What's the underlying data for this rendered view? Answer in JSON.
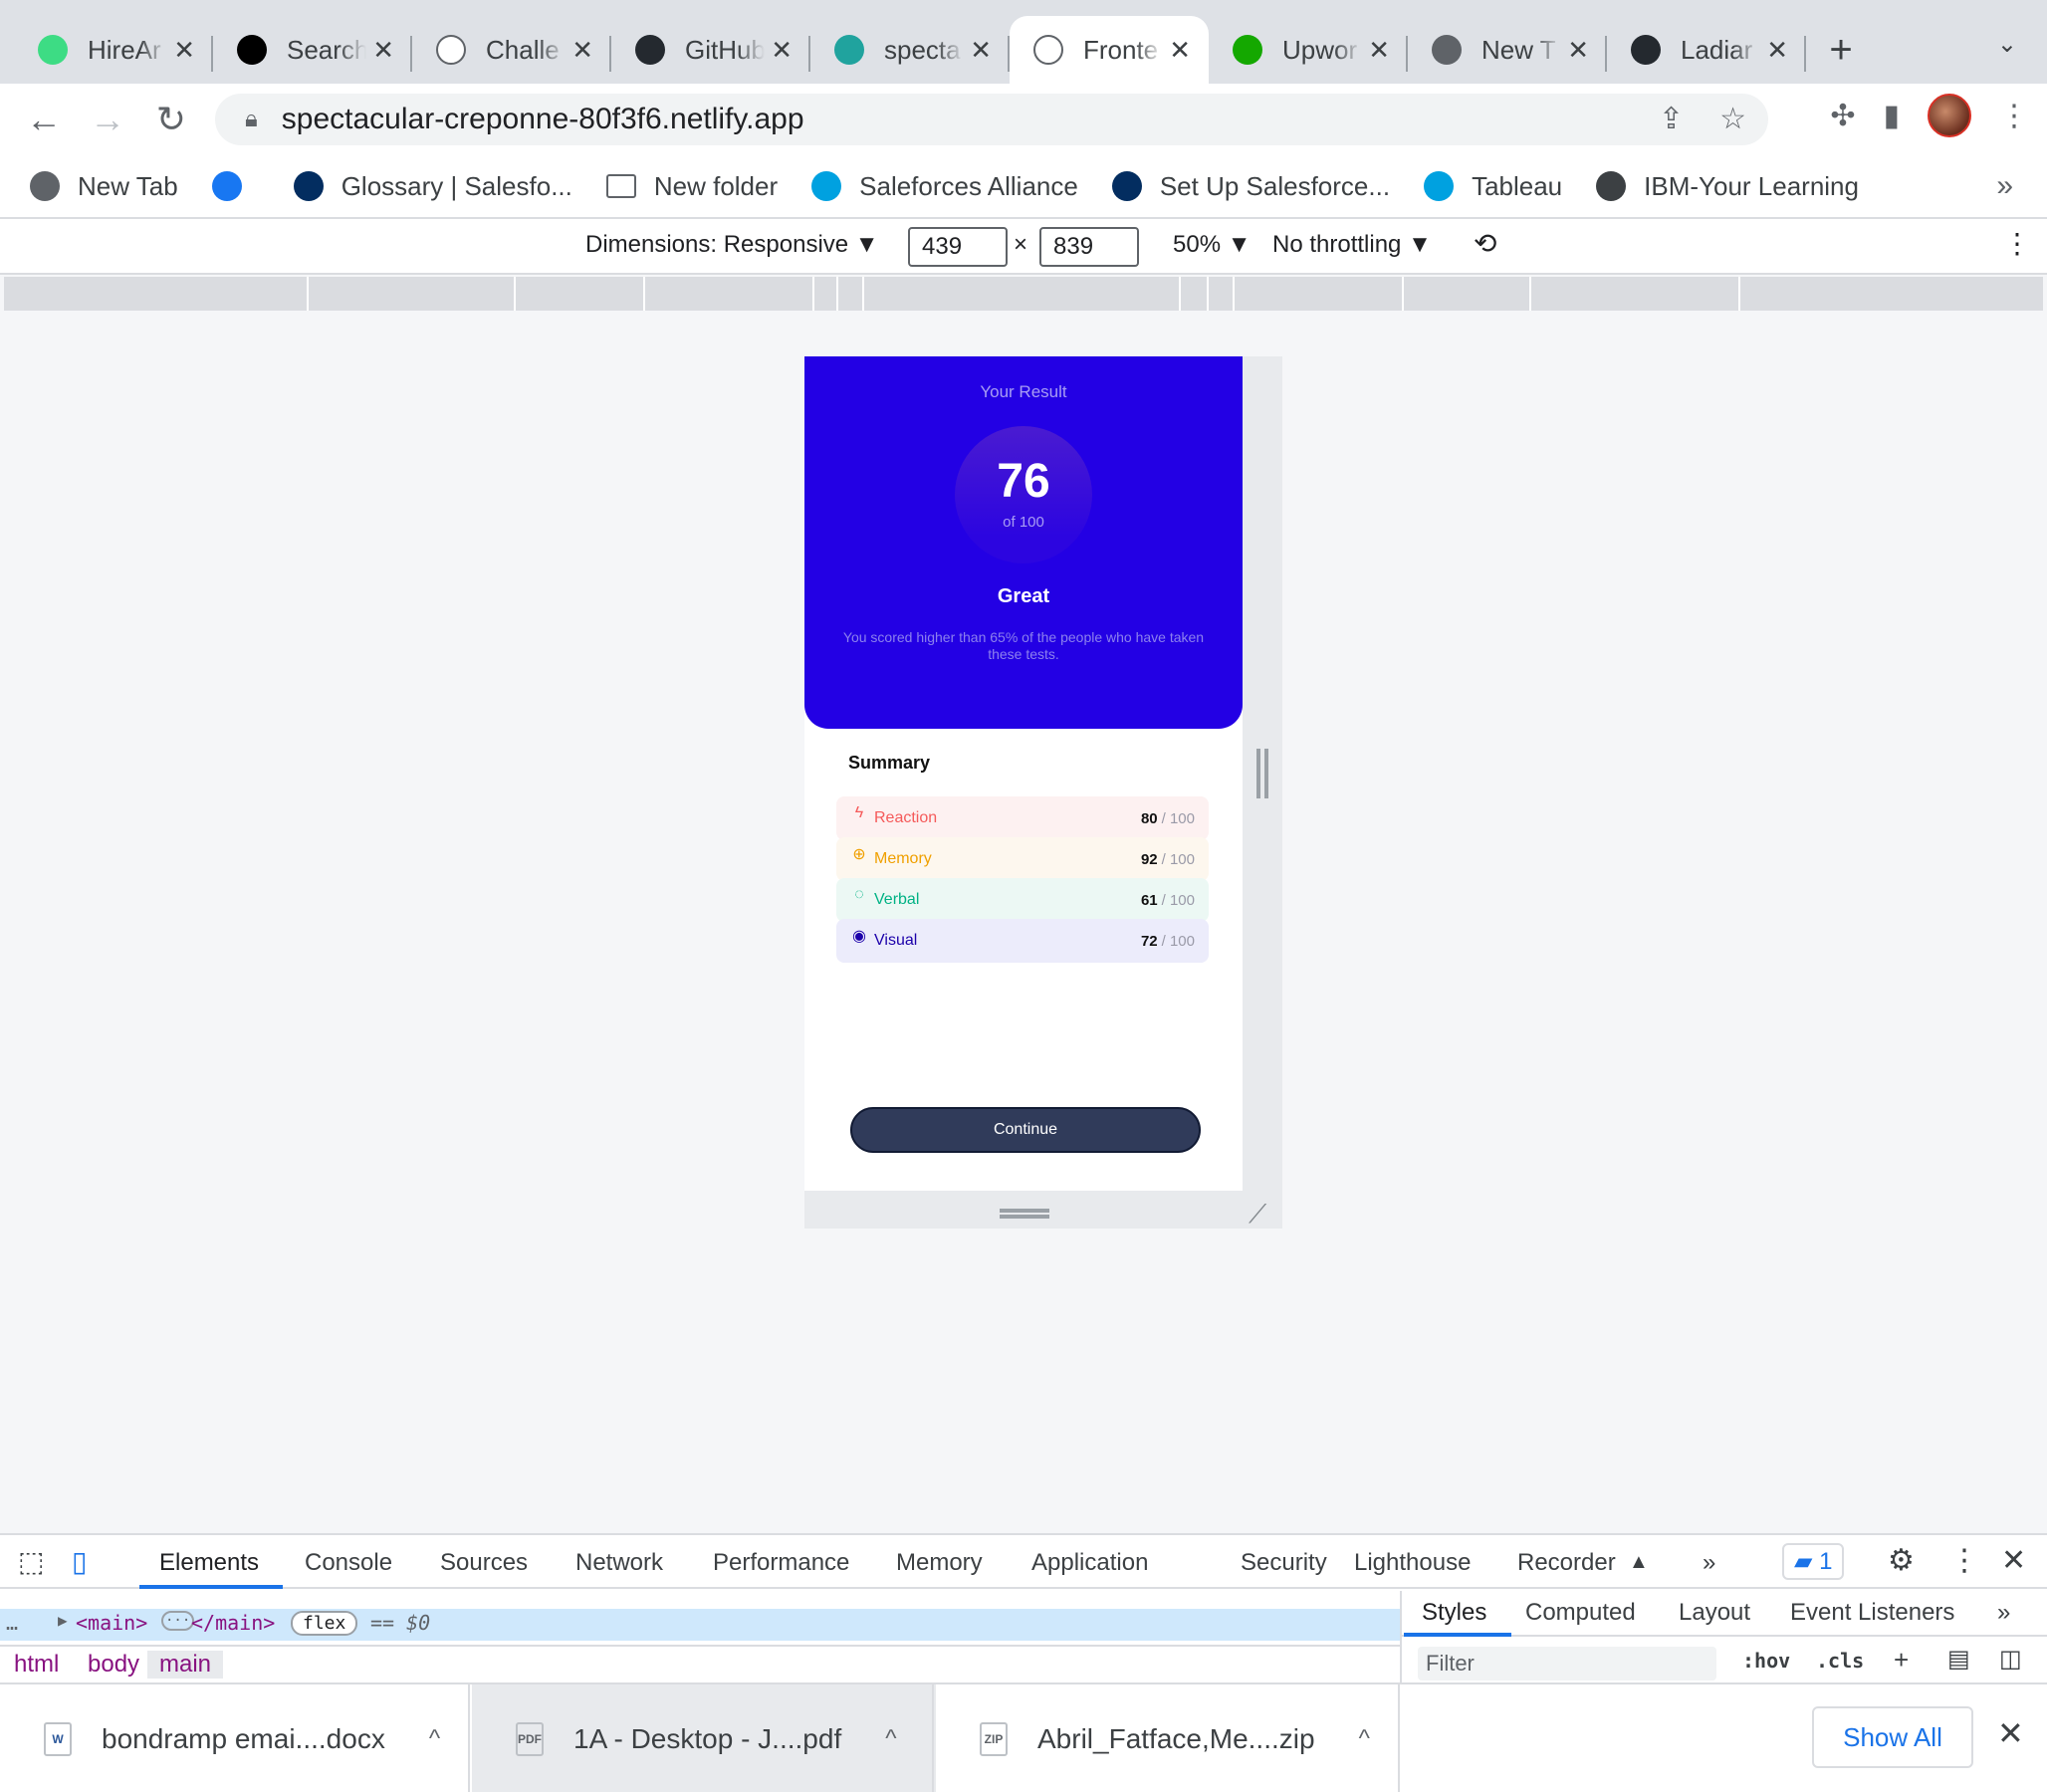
{
  "browser": {
    "tabs": [
      {
        "title": "HireAr",
        "icon": "hireahelper-icon",
        "color": "#3ddc84"
      },
      {
        "title": "Search",
        "icon": "medium-icon",
        "color": "#000000"
      },
      {
        "title": "Challe",
        "icon": "codecademy-icon",
        "color": "#ffffff"
      },
      {
        "title": "GitHub",
        "icon": "github-icon",
        "color": "#24292f"
      },
      {
        "title": "specta",
        "icon": "netlify-icon",
        "color": "#20a39e"
      },
      {
        "title": "Fronte",
        "icon": "frontend-mentor-icon",
        "color": "#ffffff"
      },
      {
        "title": "Upwor",
        "icon": "upwork-icon",
        "color": "#14a800"
      },
      {
        "title": "New T",
        "icon": "chrome-icon",
        "color": "#5f6368"
      },
      {
        "title": "Ladiar",
        "icon": "github-icon",
        "color": "#24292f"
      }
    ],
    "active_tab_index": 5,
    "tab_close_glyph": "✕",
    "new_tab_glyph": "+",
    "tab_search_glyph": "⌄",
    "url": "spectacular-creponne-80f3f6.netlify.app",
    "bookmarks": [
      {
        "label": "New Tab",
        "icon": "globe-icon",
        "color": "#5f6368"
      },
      {
        "label": "",
        "icon": "facebook-icon",
        "color": "#1877f2"
      },
      {
        "label": "Glossary | Salesfo...",
        "icon": "lightning-icon",
        "color": "#032d60"
      },
      {
        "label": "New folder",
        "icon": "folder-icon",
        "color": "#5f6368"
      },
      {
        "label": "Saleforces Alliance",
        "icon": "salesforce-cloud-icon",
        "color": "#00a1e0"
      },
      {
        "label": "Set Up Salesforce...",
        "icon": "trailhead-icon",
        "color": "#032d60"
      },
      {
        "label": "Tableau",
        "icon": "salesforce-cloud-icon",
        "color": "#00a1e0"
      },
      {
        "label": "IBM-Your Learning",
        "icon": "ibm-bee-icon",
        "color": "#3c4043"
      }
    ],
    "bookmarks_more": "»"
  },
  "device_toolbar": {
    "dimensions_label": "Dimensions: Responsive ▼",
    "width": "439",
    "times": "×",
    "height": "839",
    "zoom": "50% ▼",
    "throttling": "No throttling ▼"
  },
  "app": {
    "result_title": "Your Result",
    "score": "76",
    "score_of": "of 100",
    "grade": "Great",
    "description": "You scored higher than 65% of the people who have taken these tests.",
    "summary_title": "Summary",
    "summary": [
      {
        "label": "Reaction",
        "score": "80",
        "max": "/ 100",
        "icon": "lightning-icon",
        "color": "#f55a5a",
        "bg": "#fdf1f1",
        "glyph": "ϟ"
      },
      {
        "label": "Memory",
        "score": "92",
        "max": "/ 100",
        "icon": "brain-icon",
        "color": "#f0a000",
        "bg": "#fdf7ee",
        "glyph": "⊕"
      },
      {
        "label": "Verbal",
        "score": "61",
        "max": "/ 100",
        "icon": "chat-bubble-icon",
        "color": "#00b284",
        "bg": "#ecf8f4",
        "glyph": "◌"
      },
      {
        "label": "Visual",
        "score": "72",
        "max": "/ 100",
        "icon": "eye-icon",
        "color": "#1c00aa",
        "bg": "#ececfb",
        "glyph": "◉"
      }
    ],
    "continue_label": "Continue"
  },
  "devtools": {
    "tabs": [
      "Elements",
      "Console",
      "Sources",
      "Network",
      "Performance",
      "Memory",
      "Application",
      "Security",
      "Lighthouse",
      "Recorder"
    ],
    "more_tabs": "»",
    "issues_count": "1",
    "selected_node_open": "<main>",
    "selected_node_ellipsis": "···",
    "selected_node_close": "</main>",
    "flex_badge": "flex",
    "dollar_ref": "== $0",
    "breadcrumbs": [
      "html",
      "body",
      "main"
    ],
    "styles_tabs": [
      "Styles",
      "Computed",
      "Layout",
      "Event Listeners"
    ],
    "filter_placeholder": "Filter",
    "hov": ":hov",
    "cls": ".cls"
  },
  "downloads": {
    "items": [
      {
        "name": "bondramp emai....docx",
        "icon": "word-file-icon",
        "color": "#2b579a",
        "badge": "W"
      },
      {
        "name": "1A - Desktop - J....pdf",
        "icon": "pdf-file-icon",
        "color": "#5f6368",
        "badge": "PDF"
      },
      {
        "name": "Abril_Fatface,Me....zip",
        "icon": "zip-file-icon",
        "color": "#5f6368",
        "badge": "ZIP"
      }
    ],
    "caret": "^",
    "show_all": "Show All",
    "close": "✕"
  }
}
